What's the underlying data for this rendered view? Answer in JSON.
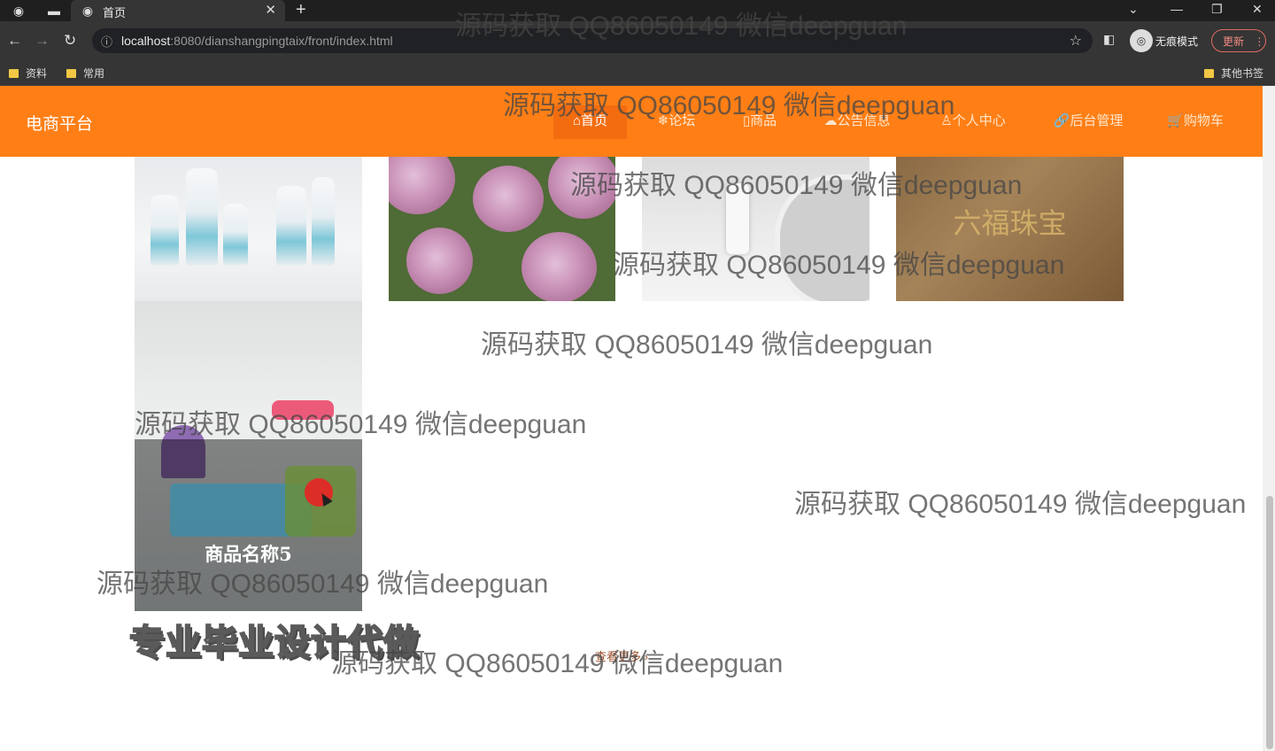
{
  "browser": {
    "tab_title": "首页",
    "url_host": "localhost",
    "url_rest": ":8080/dianshangpingtaix/front/index.html",
    "incognito_label": "无痕模式",
    "update_label": "更新",
    "bookmarks": [
      "资料",
      "常用"
    ],
    "other_bookmarks": "其他书签"
  },
  "site": {
    "brand": "电商平台",
    "nav": [
      {
        "label": "⌂首页",
        "icon": "home-icon",
        "active": true
      },
      {
        "label": "❄论坛",
        "icon": "snowflake-icon"
      },
      {
        "label": "▯商品",
        "icon": "phone-icon"
      },
      {
        "label": "☁公告信息",
        "icon": "cloud-icon"
      },
      {
        "label": "♙个人中心",
        "icon": "user-icon"
      },
      {
        "label": "🔗后台管理",
        "icon": "link-icon"
      },
      {
        "label": "🛒购物车",
        "icon": "cart-icon"
      }
    ]
  },
  "products": {
    "item5_name": "商品名称5",
    "p4_logo": "六福珠宝",
    "more_label": "查看更多 ›"
  },
  "overlay_text": {
    "promo": "专业毕业设计代做",
    "watermark": "源码获取 QQ86050149 微信deepguan"
  },
  "colors": {
    "header": "#ff7f16",
    "nav_active": "#f36c10"
  }
}
